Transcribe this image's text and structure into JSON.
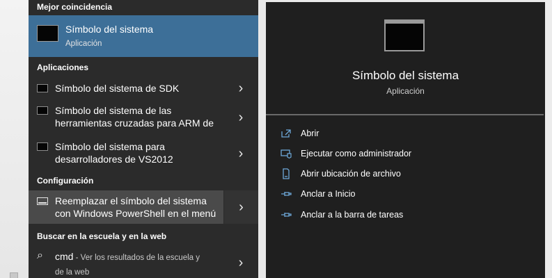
{
  "sections": {
    "best_match": "Mejor coincidencia",
    "apps": "Aplicaciones",
    "settings": "Configuración",
    "web": "Buscar en la escuela y en la web"
  },
  "best_match": {
    "title": "Símbolo del sistema",
    "subtitle": "Aplicación",
    "icon": "command-prompt-icon"
  },
  "apps": [
    {
      "line1": "Símbolo del sistema de SDK",
      "line2": ""
    },
    {
      "line1": "Símbolo del sistema de las",
      "line2": "herramientas cruzadas para ARM de"
    },
    {
      "line1": "Símbolo del sistema para",
      "line2": "desarrolladores de VS2012"
    }
  ],
  "settings_item": {
    "line1": "Reemplazar el símbolo del sistema",
    "line2": "con Windows PowerShell en el menú",
    "icon": "settings-toggle-icon"
  },
  "web_item": {
    "query": "cmd",
    "desc1": " - Ver los resultados de la escuela y",
    "desc2": "de la web",
    "icon": "search-icon"
  },
  "chevron": "›",
  "detail": {
    "title": "Símbolo del sistema",
    "subtitle": "Aplicación",
    "actions": [
      {
        "label": "Abrir",
        "icon": "open-icon"
      },
      {
        "label": "Ejecutar como administrador",
        "icon": "admin-shield-icon"
      },
      {
        "label": "Abrir ubicación de archivo",
        "icon": "file-location-icon"
      },
      {
        "label": "Anclar a Inicio",
        "icon": "pin-icon"
      },
      {
        "label": "Anclar a la barra de tareas",
        "icon": "pin-icon"
      }
    ]
  },
  "colors": {
    "accent": "#3d6f98",
    "pane_left": "#2b2b2b",
    "pane_right": "#1f1f1f",
    "icon_blue": "#6ea9d9"
  }
}
